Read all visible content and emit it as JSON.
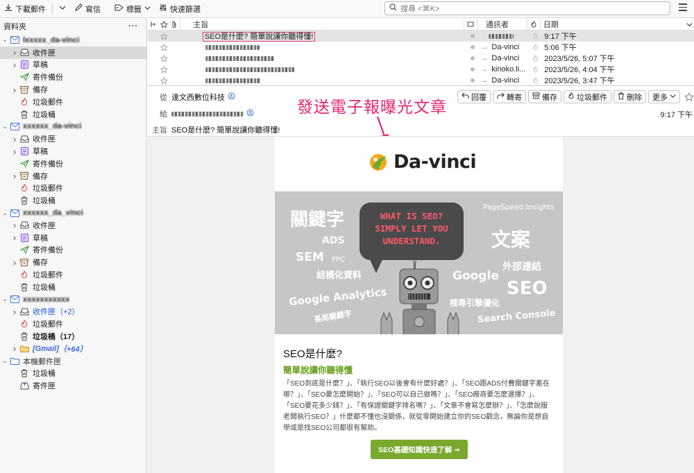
{
  "toolbar": {
    "download_label": "下載郵件",
    "write_label": "寫信",
    "tags_label": "標籤",
    "quickfilter_label": "快速篩選",
    "search_placeholder": "搜尋 <⌘K>"
  },
  "sidebar": {
    "header": "資料夾",
    "more": "···",
    "accounts": [
      {
        "name": "lxxxxx_da-vinci",
        "folders": [
          {
            "label": "收件匣",
            "icon": "inbox-icon",
            "selected": true
          },
          {
            "label": "草稿",
            "icon": "drafts-icon"
          },
          {
            "label": "寄件備份",
            "icon": "sent-icon"
          },
          {
            "label": "備存",
            "icon": "archive-icon"
          },
          {
            "label": "垃圾郵件",
            "icon": "junk-icon"
          },
          {
            "label": "垃圾桶",
            "icon": "trash-icon"
          }
        ]
      },
      {
        "name": "xxxxxx_da-vinci",
        "folders": [
          {
            "label": "收件匣",
            "icon": "inbox-icon"
          },
          {
            "label": "草稿",
            "icon": "drafts-icon"
          },
          {
            "label": "寄件備份",
            "icon": "sent-icon"
          },
          {
            "label": "備存",
            "icon": "archive-icon"
          },
          {
            "label": "垃圾郵件",
            "icon": "junk-icon"
          },
          {
            "label": "垃圾桶",
            "icon": "trash-icon"
          }
        ]
      },
      {
        "name": "xxxxxx_da_vinci",
        "folders": [
          {
            "label": "收件匣",
            "icon": "inbox-icon"
          },
          {
            "label": "草稿",
            "icon": "drafts-icon"
          },
          {
            "label": "寄件備份",
            "icon": "sent-icon"
          },
          {
            "label": "備存",
            "icon": "archive-icon"
          },
          {
            "label": "垃圾郵件",
            "icon": "junk-icon"
          },
          {
            "label": "垃圾桶",
            "icon": "trash-icon"
          }
        ]
      },
      {
        "name": "xxxxxxxxxxx",
        "folders": [
          {
            "label": "收件匣",
            "count": "（+2）",
            "icon": "inbox-icon",
            "blue": true
          },
          {
            "label": "垃圾郵件",
            "icon": "junk-icon"
          },
          {
            "label": "垃圾桶",
            "count": "（17）",
            "icon": "trash-icon",
            "bold": true
          },
          {
            "label": "[Gmail]",
            "count": "（+64）",
            "icon": "gmail-folder-icon",
            "gmail": true
          }
        ]
      },
      {
        "name": "本機郵件匣",
        "plain": true,
        "folders": [
          {
            "label": "垃圾桶",
            "icon": "trash-icon"
          },
          {
            "label": "寄件匣",
            "icon": "outbox-icon"
          }
        ]
      }
    ]
  },
  "message_list": {
    "columns": {
      "subject": "主旨",
      "correspondent": "通訊者",
      "date": "日期"
    },
    "rows": [
      {
        "subject": "SEO是什麼? 簡單說讓你聽得懂!",
        "from": "",
        "date": "9:17 下午",
        "selected": true,
        "arrow": false
      },
      {
        "subject": "",
        "from": "Da-vinci",
        "date": "5:06 下午",
        "arrow": true
      },
      {
        "subject": "",
        "from": "Da-vinci",
        "date": "2023/5/26, 5:07 下午",
        "arrow": true
      },
      {
        "subject": "",
        "from": "kinoko.li...",
        "date": "2023/5/26, 4:04 下午",
        "arrow": true
      },
      {
        "subject": "",
        "from": "Da-vinci",
        "date": "2023/5/26, 3:47 下午",
        "arrow": true
      }
    ]
  },
  "message_header": {
    "from_label": "從",
    "from_value": "達文西數位科技",
    "to_label": "給",
    "subject_label": "主旨",
    "subject_value": "SEO是什麼? 簡單說讓你聽得懂!",
    "time": "9:17 下午",
    "actions": [
      "回覆",
      "轉寄",
      "備存",
      "垃圾郵件",
      "刪除",
      "更多"
    ]
  },
  "annotation": "發送電子報曝光文章",
  "email": {
    "logo_text": "Da-vinci",
    "banner": {
      "bubble_lines": [
        "WHAT IS SEO?",
        "SIMPLY LET YOU",
        "UNDERSTAND."
      ],
      "keywords": [
        "關鍵字",
        "PageSpeed Insights",
        "ADS",
        "文案",
        "SEM",
        "PPC",
        "結構化資料",
        "外部連結",
        "Google",
        "SEO",
        "Google Analytics",
        "搜尋引擎優化",
        "長尾關鍵字",
        "Search Console"
      ]
    },
    "title": "SEO是什麼?",
    "subtitle": "簡單說讓你聽得懂",
    "paragraph": "「SEO到底是什麼？」、「執行SEO以後會有什麼好處？」、「SEO跟ADS付費關鍵字差在哪？」、「SEO要怎麼開始？」、「SEO可以自己做嗎？」、「SEO廠商要怎麼選擇？」、「SEO要花多少錢？」、「有保證關鍵字排名嗎？」、「文章不會寫怎麼辦？」、「怎麼說服老闆執行SEO？」什麼都不懂也沒關係，就從零開始建立你的SEO觀念，無論你是想自學或是找SEO公司都很有幫助。",
    "cta": "SEO基礎知識快速了解 ➟"
  },
  "colors": {
    "accent_pink": "#e32672",
    "green": "#7aa82d",
    "link_blue": "#1a56d6"
  }
}
